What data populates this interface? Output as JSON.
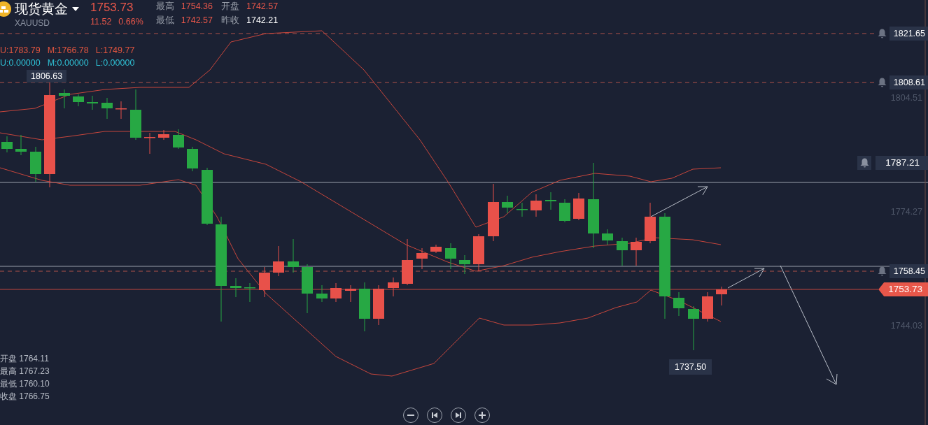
{
  "instrument": {
    "name": "现货黄金",
    "symbol": "XAUUSD",
    "price": "1753.73",
    "change": "11.52",
    "change_pct": "0.66%"
  },
  "quote_stats": [
    {
      "label": "最高",
      "value": "1754.36",
      "color": "#e8574a"
    },
    {
      "label": "开盘",
      "value": "1742.57",
      "color": "#e8574a"
    },
    {
      "label": "最低",
      "value": "1742.57",
      "color": "#e8574a"
    },
    {
      "label": "昨收",
      "value": "1742.21",
      "color": "#ffffff"
    }
  ],
  "indicator_lines": [
    {
      "values": [
        "U:1783.79",
        "M:1766.78",
        "L:1749.77"
      ],
      "color": "#e0553f"
    },
    {
      "values": [
        "U:0.00000",
        "M:0.00000",
        "L:0.00000"
      ],
      "color": "#2fc2d6"
    }
  ],
  "price_axis": {
    "labels": [
      "1804.51",
      "1774.27",
      "1744.03"
    ]
  },
  "price_lines": [
    {
      "kind": "alert",
      "value": "1821.65"
    },
    {
      "kind": "alert",
      "value": "1808.61"
    },
    {
      "kind": "alert-boxed",
      "value": "1787.21"
    },
    {
      "kind": "alert",
      "value": "1758.45"
    },
    {
      "kind": "current",
      "value": "1753.73"
    }
  ],
  "high_marker": "1806.63",
  "low_marker": "1737.50",
  "ohlc_summary": [
    {
      "label": "开盘",
      "value": "1764.11"
    },
    {
      "label": "最高",
      "value": "1767.23"
    },
    {
      "label": "最低",
      "value": "1760.10"
    },
    {
      "label": "收盘",
      "value": "1766.75"
    }
  ]
}
